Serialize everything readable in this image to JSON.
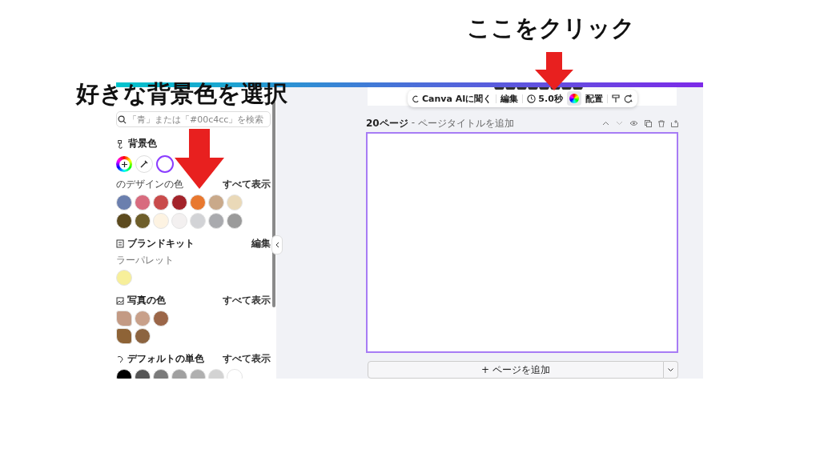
{
  "annotations": [
    {
      "text": "ここをクリック"
    },
    {
      "text": "好きな背景色を選択"
    }
  ],
  "panel": {
    "search": {
      "placeholder": "「青」または「#00c4cc」を検索"
    },
    "background": {
      "title": "背景色"
    },
    "design_colors": {
      "label": "のデザインの色",
      "action": "すべて表示",
      "colors": [
        {
          "color": "#6b7fae"
        },
        {
          "color": "#d86b7e"
        },
        {
          "color": "#c94b4b"
        },
        {
          "color": "#a3232a"
        },
        {
          "color": "#e8782f"
        },
        {
          "color": "#c9a98a"
        },
        {
          "color": "#ead9b8"
        },
        {
          "color": "#5c4a1e"
        },
        {
          "color": "#6e5e2a"
        },
        {
          "color": "#fdf3e2"
        },
        {
          "color": "#f3f0f0"
        },
        {
          "color": "#d2d3d6"
        },
        {
          "color": "#a9aaae"
        },
        {
          "color": "#9a9a9a"
        }
      ]
    },
    "brand_kit": {
      "title": "ブランドキット",
      "action": "編集",
      "sublabel": "ラーパレット",
      "colors": [
        {
          "color": "#f7ef9a"
        }
      ]
    },
    "photo_colors": {
      "title": "写真の色",
      "action": "すべて表示",
      "rows": [
        [
          {
            "kind": "blob",
            "color": "#c39a84"
          },
          {
            "kind": "circle",
            "color": "#c8a08a"
          },
          {
            "kind": "circle",
            "color": "#9b6648"
          }
        ],
        [
          {
            "kind": "blob",
            "color": "#8e6336"
          },
          {
            "kind": "circle",
            "color": "#8c6440"
          }
        ]
      ]
    },
    "default_colors": {
      "title": "デフォルトの単色",
      "action": "すべて表示",
      "colors": [
        {
          "color": "#000000"
        },
        {
          "color": "#555555"
        },
        {
          "color": "#7a7a7a"
        },
        {
          "color": "#a0a0a0"
        },
        {
          "color": "#b0b0b0"
        },
        {
          "color": "#d3d3d3"
        },
        {
          "color": "#ffffff"
        }
      ]
    }
  },
  "toolbar": {
    "ask_ai": "Canva AIに聞く",
    "edit": "編集",
    "duration": "5.0秒",
    "arrange": "配置"
  },
  "page": {
    "number": "20ページ",
    "separator": "-",
    "title_placeholder": "ページタイトルを追加"
  },
  "add_page": "+ ページを追加"
}
